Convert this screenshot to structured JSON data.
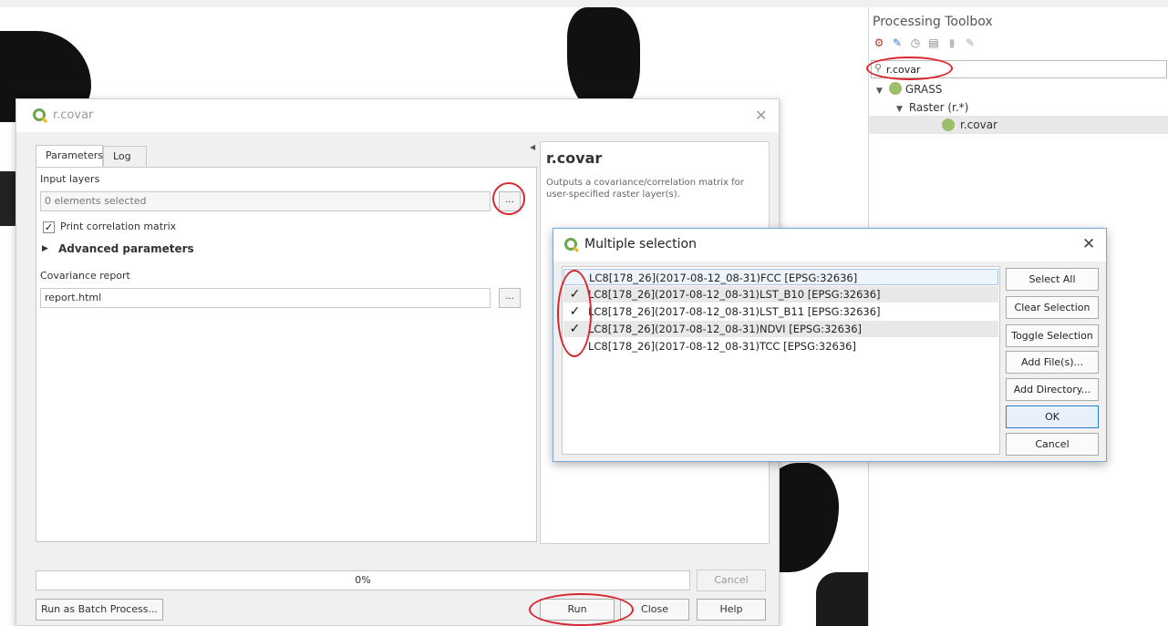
{
  "toolbox": {
    "title": "Processing Toolbox",
    "search_value": "r.covar",
    "tree": {
      "group": "GRASS",
      "subgroup": "Raster (r.*)",
      "algorithm": "r.covar"
    }
  },
  "dialog": {
    "title": "r.covar",
    "tabs": [
      "Parameters",
      "Log"
    ],
    "input_layers_label": "Input layers",
    "input_layers_value": "0 elements selected",
    "browse_label": "...",
    "print_matrix_label": "Print correlation matrix",
    "print_matrix_checked": true,
    "advanced_label": "Advanced parameters",
    "covariance_label": "Covariance report",
    "covariance_value": "report.html",
    "help_title": "r.covar",
    "help_text": "Outputs a covariance/correlation matrix for user-specified raster layer(s).",
    "progress_text": "0%",
    "cancel_label": "Cancel",
    "batch_label": "Run as Batch Process...",
    "run_label": "Run",
    "close_label": "Close",
    "help_label": "Help"
  },
  "multi_select": {
    "title": "Multiple selection",
    "items": [
      {
        "label": "LC8[178_26](2017-08-12_08-31)FCC [EPSG:32636]",
        "checked": false
      },
      {
        "label": "LC8[178_26](2017-08-12_08-31)LST_B10 [EPSG:32636]",
        "checked": true
      },
      {
        "label": "LC8[178_26](2017-08-12_08-31)LST_B11 [EPSG:32636]",
        "checked": true
      },
      {
        "label": "LC8[178_26](2017-08-12_08-31)NDVI [EPSG:32636]",
        "checked": true
      },
      {
        "label": "LC8[178_26](2017-08-12_08-31)TCC [EPSG:32636]",
        "checked": false
      }
    ],
    "buttons": {
      "select_all": "Select All",
      "clear_selection": "Clear Selection",
      "toggle_selection": "Toggle Selection",
      "add_files": "Add File(s)...",
      "add_directory": "Add Directory...",
      "ok": "OK",
      "cancel": "Cancel"
    },
    "check_glyph": "✓"
  },
  "colors": {
    "annotation_red": "#d9262f",
    "qgis_green": "#6aa84f",
    "accent_blue": "#2b7cd3"
  }
}
